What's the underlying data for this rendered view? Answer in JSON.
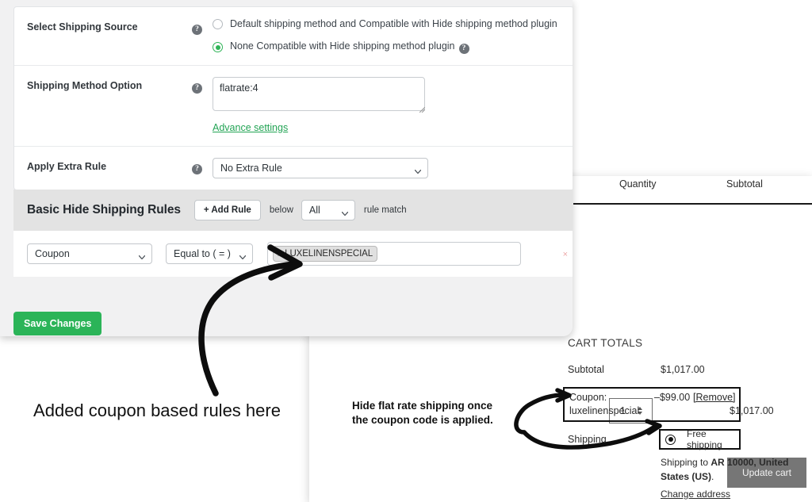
{
  "settings": {
    "rows": [
      {
        "label": "Select Shipping Source",
        "help": "?",
        "options": [
          {
            "label": "Default shipping method and Compatible with Hide shipping method plugin",
            "selected": false
          },
          {
            "label": "None Compatible with Hide shipping method plugin",
            "selected": true
          }
        ]
      },
      {
        "label": "Shipping Method Option",
        "help": "?",
        "textarea_value": "flatrate:4",
        "link_label": "Advance settings"
      },
      {
        "label": "Apply Extra Rule",
        "help": "?",
        "select_value": "No Extra Rule"
      }
    ],
    "rules": {
      "title": "Basic Hide Shipping Rules",
      "add_rule_label": "+ Add Rule",
      "below_label": "below",
      "match_select_value": "All",
      "match_suffix_label": "rule match",
      "row": {
        "field_value": "Coupon",
        "operator_value": "Equal to ( = )",
        "tag_remove_icon": "x",
        "tag_value": "LUXELINENSPECIAL",
        "delete_icon": "×"
      }
    },
    "save_label": "Save Changes",
    "accent_green": "#2bb458",
    "link_green": "#23a455"
  },
  "cart": {
    "columns": {
      "quantity": "Quantity",
      "subtotal": "Subtotal"
    },
    "line_item": {
      "quantity": "1",
      "subtotal": "$1,017.00"
    },
    "update_cart_label": "Update cart",
    "totals_heading": "CART TOTALS",
    "subtotal_label": "Subtotal",
    "subtotal_value": "$1,017.00",
    "coupon_label": "Coupon:",
    "coupon_code": "luxelinenspecial",
    "coupon_value": "–$99.00",
    "coupon_remove": "[Remove]",
    "shipping_label": "Shipping",
    "shipping_option": "Free shipping",
    "shipping_to_prefix": "Shipping to ",
    "shipping_to_address": "AR 10000, United States (US)",
    "shipping_to_suffix": ".",
    "change_address_label": "Change address"
  },
  "annotations": {
    "left": "Added coupon based rules here",
    "middle": "Hide flat rate shipping once the coupon code is applied."
  }
}
